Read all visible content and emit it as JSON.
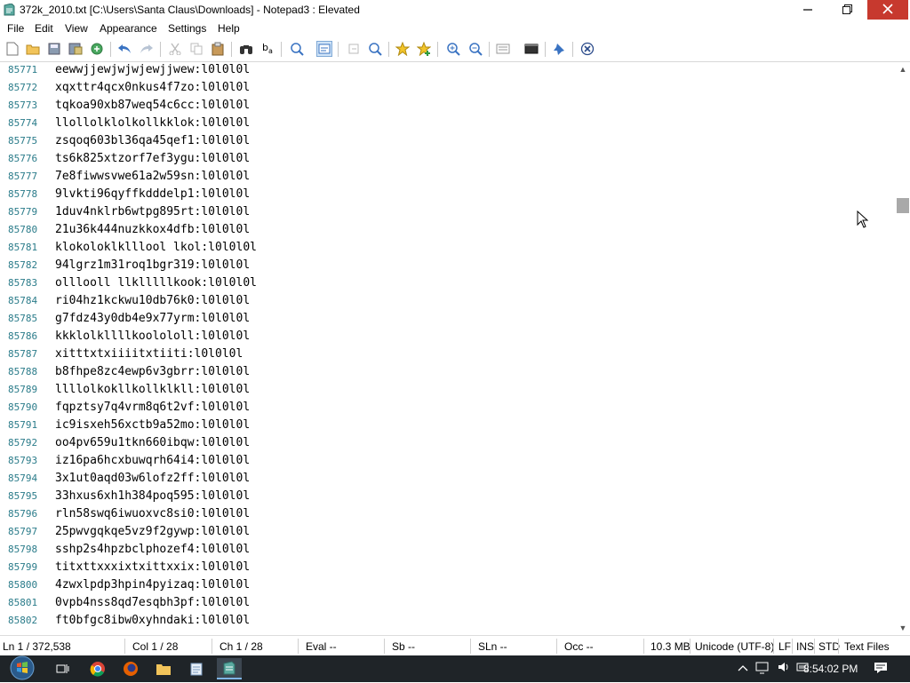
{
  "window": {
    "title": "372k_2010.txt [C:\\Users\\Santa Claus\\Downloads] - Notepad3 : Elevated",
    "minimize_icon": "minimize-icon",
    "maximize_icon": "restore-icon",
    "close_icon": "close-icon",
    "close_color": "#c7392e"
  },
  "menu": {
    "items": [
      "File",
      "Edit",
      "View",
      "Appearance",
      "Settings",
      "Help"
    ]
  },
  "toolbar": {
    "buttons": [
      "new-file-icon",
      "open-folder-icon",
      "save-icon",
      "save-as-icon",
      "reload-icon",
      "undo-icon",
      "redo-icon",
      "cut-icon",
      "copy-icon",
      "paste-icon",
      "find-icon",
      "replace-icon",
      "find-in-files-icon",
      "word-wrap-icon",
      "goto-icon",
      "zoom-selection-icon",
      "favorite-icon",
      "add-favorite-icon",
      "zoom-in-icon",
      "zoom-out-icon",
      "scheme-icon",
      "terminal-icon",
      "pin-icon",
      "close-doc-icon"
    ],
    "active_button": "word-wrap-icon"
  },
  "editor": {
    "line_number_color": "#2b7c8a",
    "lines": [
      {
        "num": "85771",
        "text": "eewwjjewjwjwjewjjwew:l0l0l0l"
      },
      {
        "num": "85772",
        "text": "xqxttr4qcx0nkus4f7zo:l0l0l0l"
      },
      {
        "num": "85773",
        "text": "tqkoa90xb87weq54c6cc:l0l0l0l"
      },
      {
        "num": "85774",
        "text": "llollolklolkollkklok:l0l0l0l"
      },
      {
        "num": "85775",
        "text": "zsqoq603bl36qa45qef1:l0l0l0l"
      },
      {
        "num": "85776",
        "text": "ts6k825xtzorf7ef3ygu:l0l0l0l"
      },
      {
        "num": "85777",
        "text": "7e8fiwwsvwe61a2w59sn:l0l0l0l"
      },
      {
        "num": "85778",
        "text": "9lvkti96qyffkdddelp1:l0l0l0l"
      },
      {
        "num": "85779",
        "text": "1duv4nklrb6wtpg895rt:l0l0l0l"
      },
      {
        "num": "85780",
        "text": "21u36k444nuzkkox4dfb:l0l0l0l"
      },
      {
        "num": "85781",
        "text": "klokoloklklllool lkol:l0l0l0l"
      },
      {
        "num": "85782",
        "text": "94lgrz1m31roq1bgr319:l0l0l0l"
      },
      {
        "num": "85783",
        "text": "olllooll llklllllkook:l0l0l0l"
      },
      {
        "num": "85784",
        "text": "ri04hz1kckwu10db76k0:l0l0l0l"
      },
      {
        "num": "85785",
        "text": "g7fdz43y0db4e9x77yrm:l0l0l0l"
      },
      {
        "num": "85786",
        "text": "kkklolkllllkoolololl:l0l0l0l"
      },
      {
        "num": "85787",
        "text": "xitttxtxiiiitxtiiti:l0l0l0l"
      },
      {
        "num": "85788",
        "text": "b8fhpe8zc4ewp6v3gbrr:l0l0l0l"
      },
      {
        "num": "85789",
        "text": "llllolkokllkollklkll:l0l0l0l"
      },
      {
        "num": "85790",
        "text": "fqpztsy7q4vrm8q6t2vf:l0l0l0l"
      },
      {
        "num": "85791",
        "text": "ic9isxeh56xctb9a52mo:l0l0l0l"
      },
      {
        "num": "85792",
        "text": "oo4pv659u1tkn660ibqw:l0l0l0l"
      },
      {
        "num": "85793",
        "text": "iz16pa6hcxbuwqrh64i4:l0l0l0l"
      },
      {
        "num": "85794",
        "text": "3x1ut0aqd03w6lofz2ff:l0l0l0l"
      },
      {
        "num": "85795",
        "text": "33hxus6xh1h384poq595:l0l0l0l"
      },
      {
        "num": "85796",
        "text": "rln58swq6iwuoxvc8si0:l0l0l0l"
      },
      {
        "num": "85797",
        "text": "25pwvgqkqe5vz9f2gywp:l0l0l0l"
      },
      {
        "num": "85798",
        "text": "sshp2s4hpzbclphozef4:l0l0l0l"
      },
      {
        "num": "85799",
        "text": "titxttxxxixtxittxxix:l0l0l0l"
      },
      {
        "num": "85800",
        "text": "4zwxlpdp3hpin4pyizaq:l0l0l0l"
      },
      {
        "num": "85801",
        "text": "0vpb4nss8qd7esqbh3pf:l0l0l0l"
      },
      {
        "num": "85802",
        "text": "ft0bfgc8ibw0xyhndaki:l0l0l0l"
      }
    ]
  },
  "scrollbar": {
    "position_fraction": 0.23
  },
  "status": {
    "line": "Ln 1 / 372,538",
    "col": "Col 1 / 28",
    "ch": "Ch 1 / 28",
    "eval": "Eval --",
    "sb": "Sb --",
    "sln": "SLn --",
    "occ": "Occ --",
    "size": "10.3 MB",
    "encoding": "Unicode (UTF-8)",
    "eol": "LF",
    "ins": "INS",
    "std": "STD",
    "filetype": "Text Files"
  },
  "taskbar": {
    "apps": [
      "task-view-icon",
      "chrome-icon",
      "firefox-icon",
      "file-explorer-icon",
      "notepad-icon",
      "notepad3-icon"
    ],
    "active_app": "notepad3-icon",
    "tray": [
      "show-hidden-icon",
      "network-icon",
      "volume-icon",
      "language-icon"
    ],
    "clock": "8:54:02 PM",
    "notification_icon": "action-center-icon"
  }
}
